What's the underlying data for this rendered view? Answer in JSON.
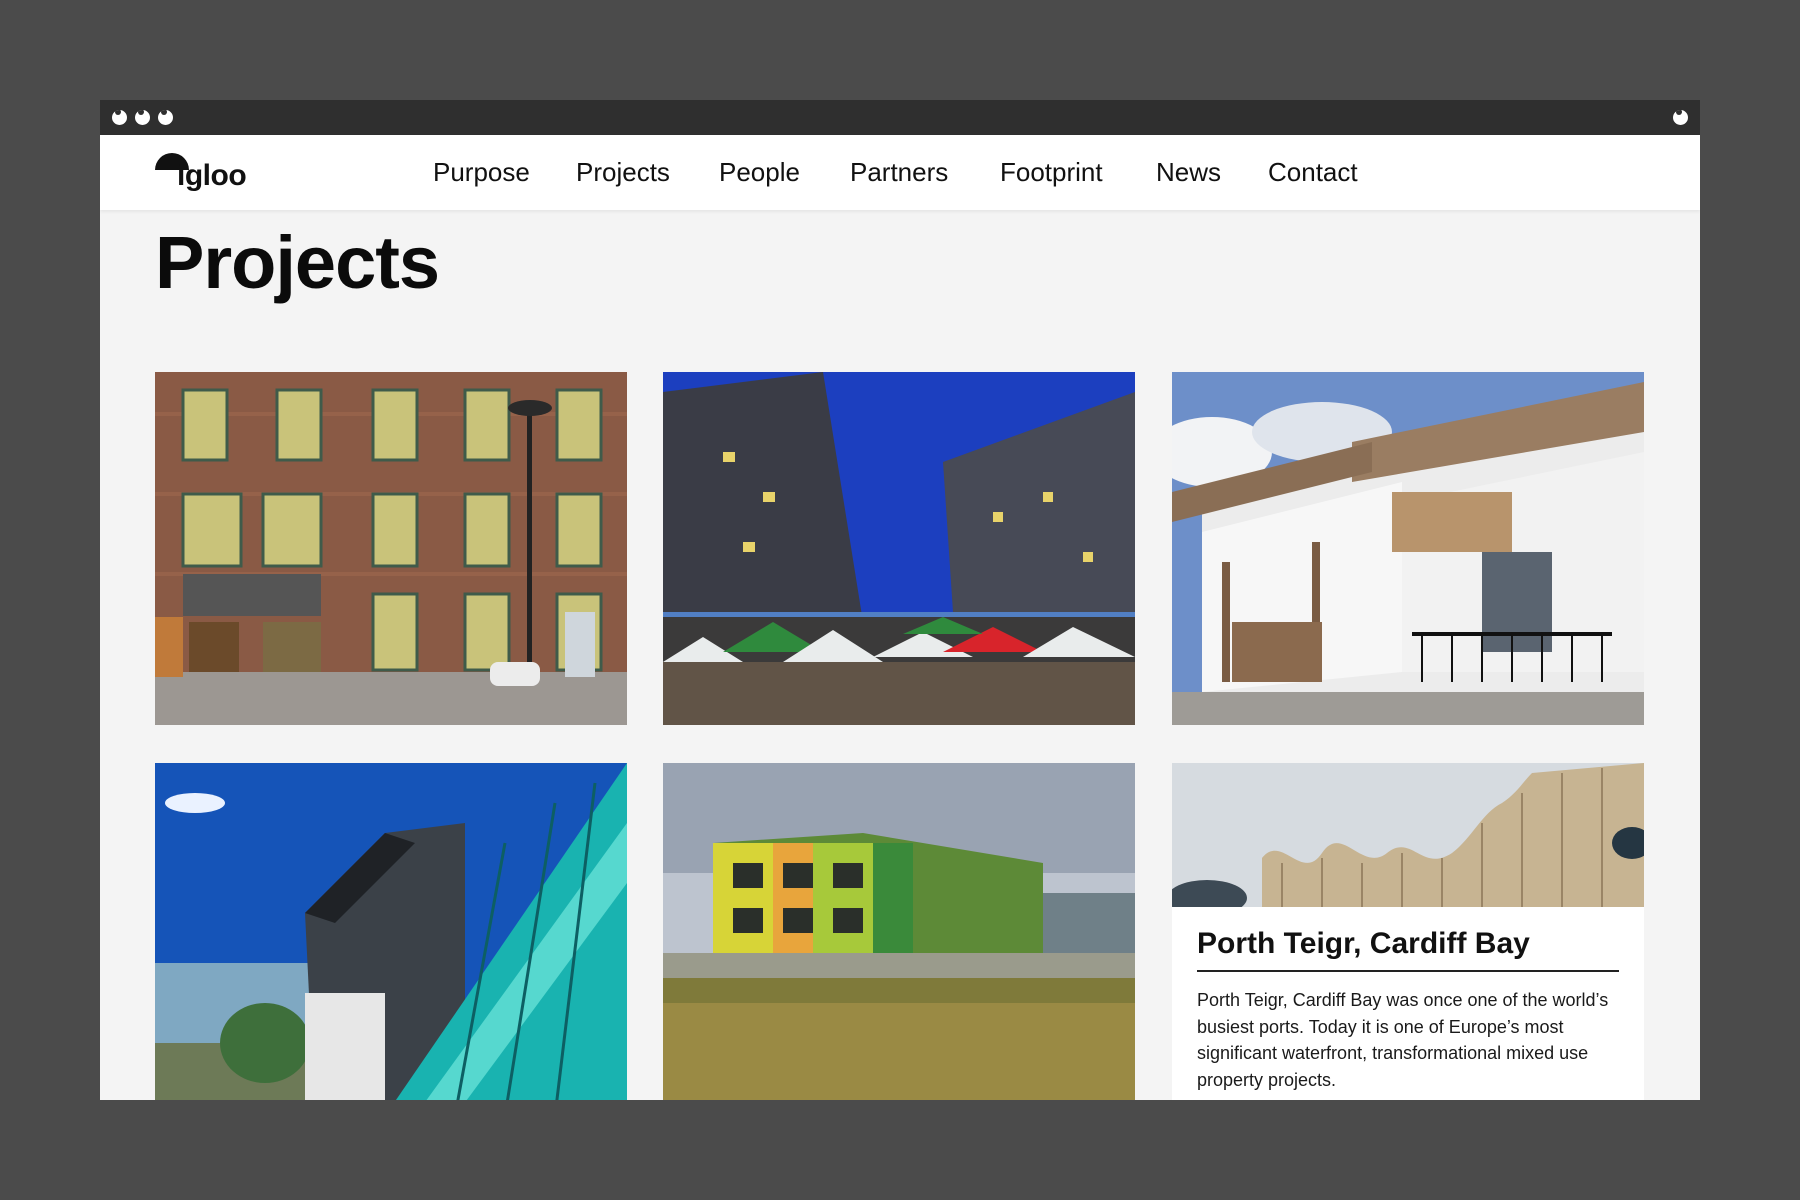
{
  "window": {
    "controls": [
      "close-control",
      "minimize-control",
      "maximize-control"
    ]
  },
  "brand": {
    "logo_text": "igloo"
  },
  "nav": {
    "items": [
      {
        "label": "Purpose"
      },
      {
        "label": "Projects"
      },
      {
        "label": "People"
      },
      {
        "label": "Partners"
      },
      {
        "label": "Footprint"
      },
      {
        "label": "News"
      },
      {
        "label": "Contact"
      }
    ]
  },
  "page": {
    "title": "Projects"
  },
  "projects": {
    "featured": {
      "title": "Porth Teigr, Cardiff Bay",
      "description": "Porth Teigr, Cardiff Bay was once one of the world’s busiest ports. Today it is one of Europe’s most significant waterfront, transformational mixed use property projects."
    }
  },
  "colors": {
    "backdrop": "#4b4b4b",
    "titlebar": "#2f2f2f",
    "page_background": "#f4f4f4",
    "text": "#111111"
  }
}
